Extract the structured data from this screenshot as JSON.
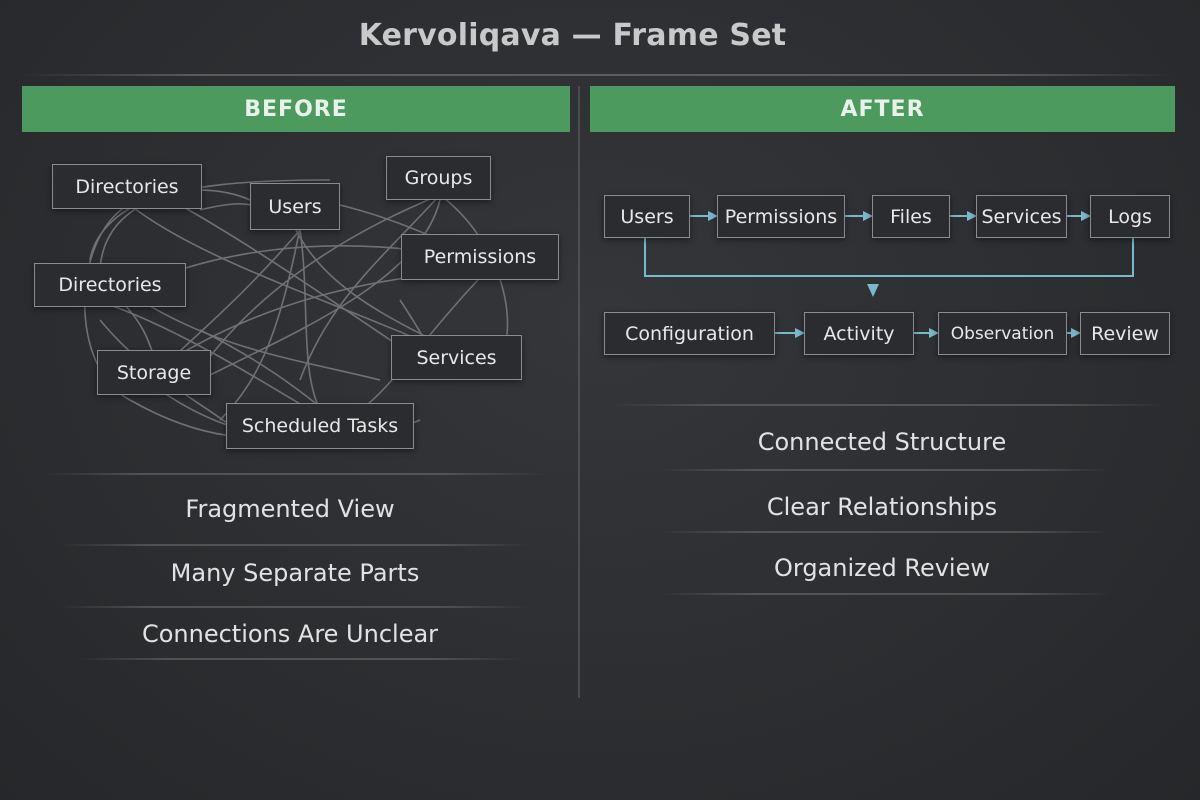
{
  "title": "Kervoliqava — Frame Set",
  "colors": {
    "header_green": "#4d9a5f",
    "arrow_blue": "#7ab8cc",
    "background": "#2c2e31",
    "node_border": "#8a8c90"
  },
  "before": {
    "header": "BEFORE",
    "nodes": [
      "Directories",
      "Users",
      "Groups",
      "Permissions",
      "Directories",
      "Storage",
      "Services",
      "Scheduled Tasks"
    ],
    "summary": [
      "Fragmented View",
      "Many Separate Parts",
      "Connections Are Unclear"
    ]
  },
  "after": {
    "header": "AFTER",
    "row1": [
      "Users",
      "Permissions",
      "Files",
      "Services",
      "Logs"
    ],
    "row2": [
      "Configuration",
      "Activity",
      "Observation",
      "Review"
    ],
    "summary": [
      "Connected Structure",
      "Clear Relationships",
      "Organized Review"
    ]
  }
}
